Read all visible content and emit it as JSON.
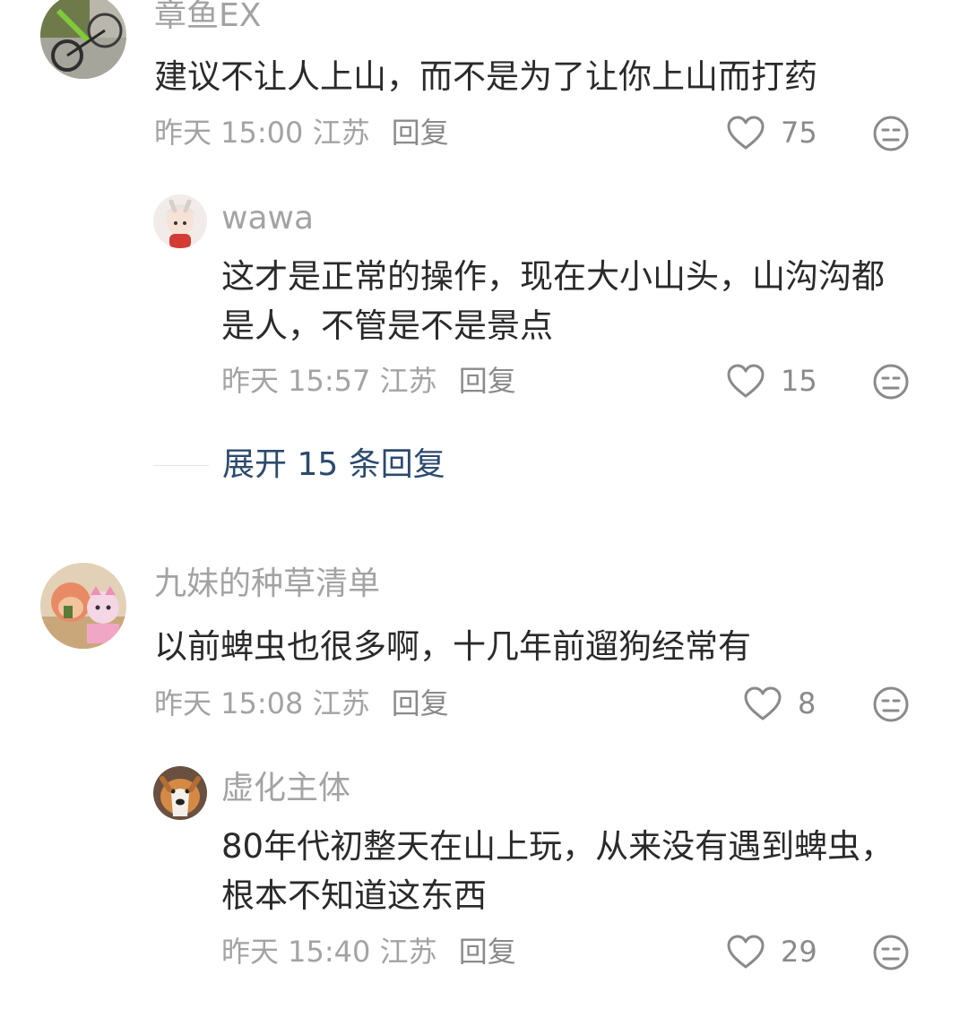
{
  "comments": [
    {
      "user": "章鱼EX",
      "text": "建议不让人上山，而不是为了让你上山而打药",
      "time": "昨天 15:00",
      "location": "江苏",
      "reply_label": "回复",
      "likes": "75",
      "replies": [
        {
          "user": "wawa",
          "text": "这才是正常的操作，现在大小山头，山沟沟都是人，不管是不是景点",
          "time": "昨天 15:57",
          "location": "江苏",
          "reply_label": "回复",
          "likes": "15"
        }
      ],
      "expand_label": "展开 15 条回复"
    },
    {
      "user": "九妹的种草清单",
      "text": "以前蜱虫也很多啊，十几年前遛狗经常有",
      "time": "昨天 15:08",
      "location": "江苏",
      "reply_label": "回复",
      "likes": "8",
      "replies": [
        {
          "user": "虚化主体",
          "text": "80年代初整天在山上玩，从来没有遇到蜱虫，根本不知道这东西",
          "time": "昨天 15:40",
          "location": "江苏",
          "reply_label": "回复",
          "likes": "29"
        }
      ]
    }
  ],
  "colors": {
    "username": "#a3a3a3",
    "text": "#2a2a2a",
    "meta": "#a3a3a3",
    "expand_link": "#2c4a6e"
  },
  "icons": {
    "like": "heart-outline-icon",
    "dislike": "meh-face-icon"
  }
}
